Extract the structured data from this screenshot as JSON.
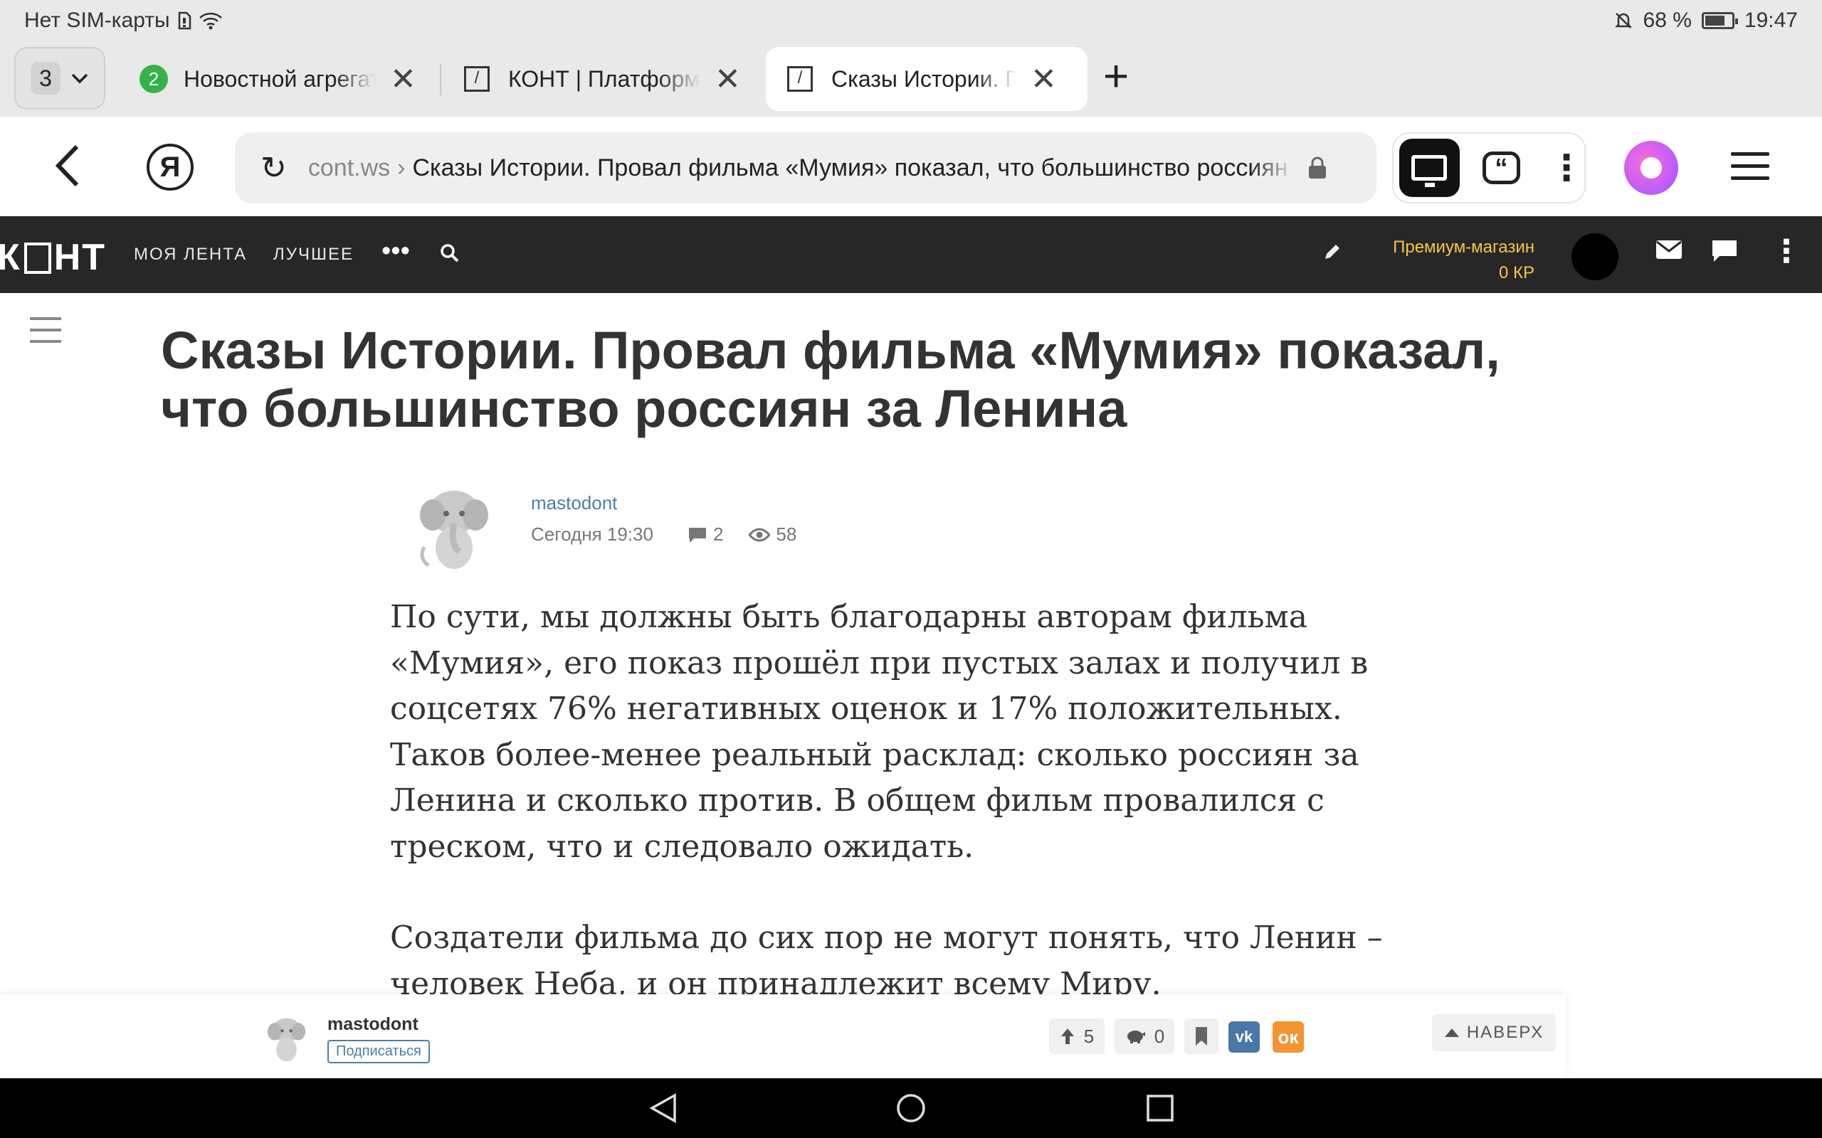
{
  "status_bar": {
    "carrier": "Нет SIM-карты",
    "battery": "68 %",
    "battery_level": 0.68,
    "time": "19:47"
  },
  "tabs": {
    "count": "3",
    "items": [
      {
        "badge": "2",
        "title": "Новостной агрегатор"
      },
      {
        "title": "КОНТ | Платформа"
      },
      {
        "title": "Сказы Истории. Провал"
      }
    ]
  },
  "address_bar": {
    "domain": "cont.ws",
    "separator": "›",
    "path": "Сказы Истории. Провал фильма «Мумия» показал, что большинство россиян за Ленина"
  },
  "site_nav": {
    "logo_left": "К",
    "logo_right": "НТ",
    "links": [
      "МОЯ ЛЕНТА",
      "ЛУЧШЕЕ"
    ],
    "premium_label": "Премиум-магазин",
    "premium_balance": "0 КР"
  },
  "article": {
    "title": "Сказы Истории. Провал фильма «Мумия» показал, что большинство россиян за Ленина",
    "author": "mastodont",
    "date": "Сегодня 19:30",
    "comments": "2",
    "views": "58",
    "paragraphs": [
      "По сути, мы должны быть благодарны авторам фильма «Мумия», его показ прошёл при пустых залах и получил в соцсетях 76% негативных оценок и 17% положительных. Таков более-менее реальный расклад: сколько россиян за Ленина и сколько против. В общем фильм провалился с треском, что и следовало ожидать.",
      "Создатели фильма до сих пор не могут понять, что Ленин – человек Неба, и он принадлежит всему Миру."
    ]
  },
  "bottom_bar": {
    "author": "mastodont",
    "subscribe": "Подписаться",
    "likes": "5",
    "donations": "0",
    "to_top": "НАВЕРХ"
  },
  "colors": {
    "nav_bg": "#272727",
    "premium": "#f2c744",
    "link": "#4a7fa7",
    "vk": "#4a76a8",
    "ok": "#f59330"
  }
}
